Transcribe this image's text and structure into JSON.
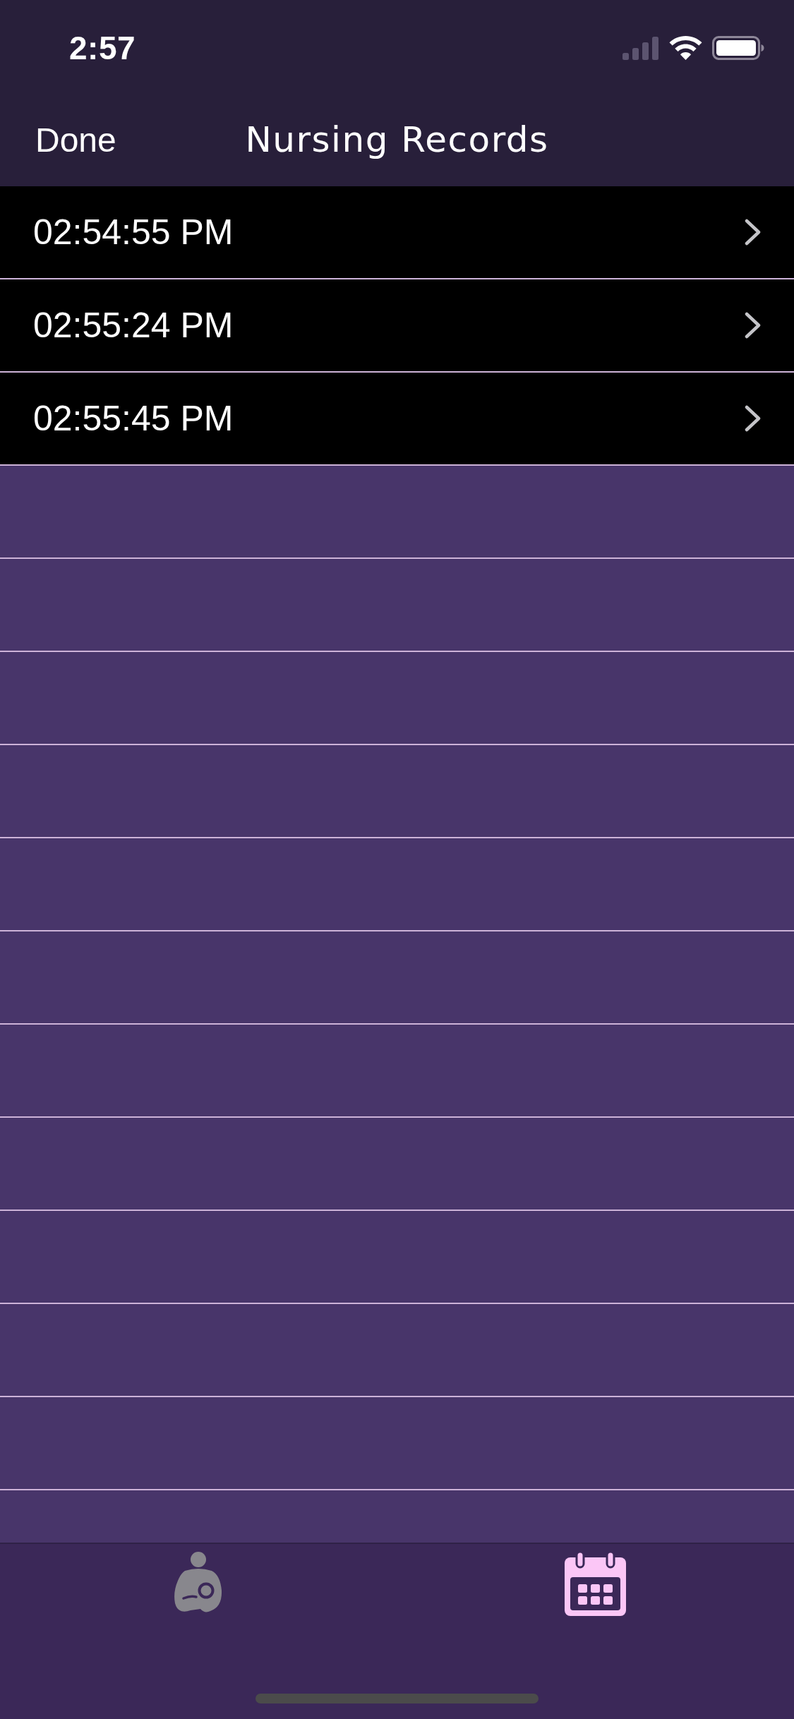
{
  "status_bar": {
    "time": "2:57"
  },
  "nav_bar": {
    "done_button": "Done",
    "title": "Nursing Records"
  },
  "records": [
    {
      "time": "02:54:55 PM"
    },
    {
      "time": "02:55:24 PM"
    },
    {
      "time": "02:55:45 PM"
    }
  ],
  "tab_bar": {
    "tabs": [
      {
        "kind": "nursing",
        "selected": false
      },
      {
        "kind": "calendar",
        "selected": true
      }
    ]
  }
}
